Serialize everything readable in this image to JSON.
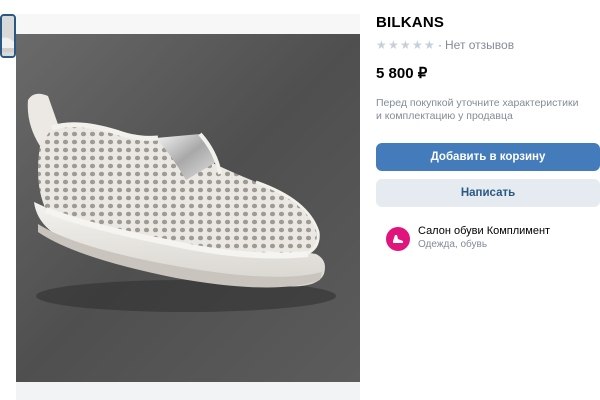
{
  "product": {
    "title": "BILKANS",
    "rating_stars": 5,
    "rating_filled": 0,
    "reviews_text": "Нет отзывов",
    "price": "5 800 ₽",
    "note": "Перед покупкой уточните характеристики и комплектацию у продавца"
  },
  "actions": {
    "add_to_cart": "Добавить в корзину",
    "message": "Написать"
  },
  "seller": {
    "name": "Салон обуви Комплимент",
    "category": "Одежда, обувь"
  },
  "colors": {
    "primary_button": "#447bba",
    "secondary_button": "#e5ebf1",
    "avatar": "#e0147a"
  }
}
